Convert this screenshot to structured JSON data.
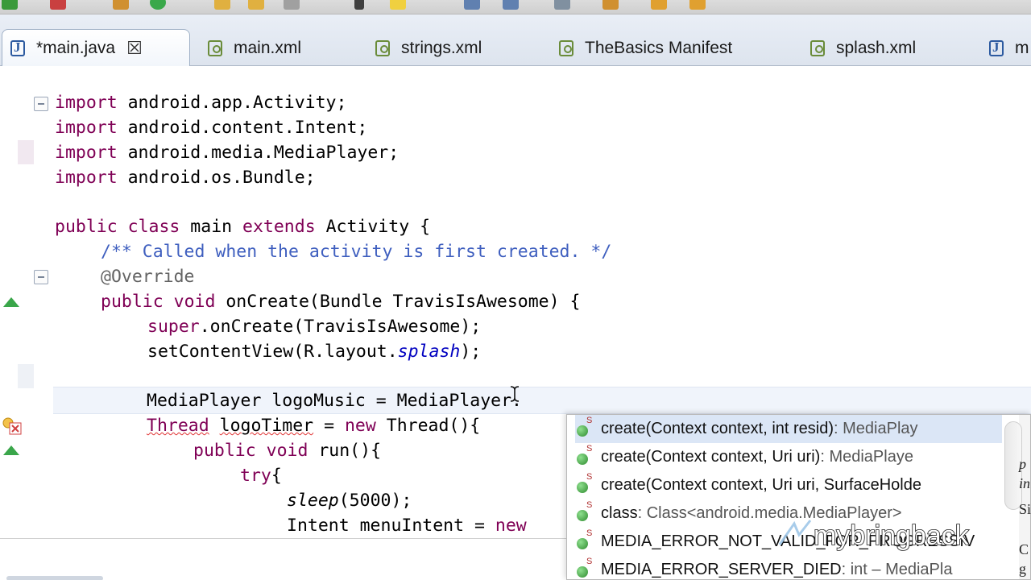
{
  "tabs": [
    {
      "label": "*main.java",
      "icon": "java-file-icon",
      "active": true
    },
    {
      "label": "main.xml",
      "icon": "xml-file-icon"
    },
    {
      "label": "strings.xml",
      "icon": "xml-file-icon"
    },
    {
      "label": "TheBasics Manifest",
      "icon": "xml-file-icon"
    },
    {
      "label": "splash.xml",
      "icon": "xml-file-icon"
    },
    {
      "label": "m",
      "icon": "java-file-icon"
    }
  ],
  "code": {
    "l1_kw": "import",
    "l1": " android.app.Activity;",
    "l2_kw": "import",
    "l2": " android.content.Intent;",
    "l3_kw": "import",
    "l3": " android.media.MediaPlayer;",
    "l4_kw": "import",
    "l4": " android.os.Bundle;",
    "l6_kw1": "public",
    "l6_kw2": "class",
    "l6_a": " main ",
    "l6_kw3": "extends",
    "l6_b": " Activity {",
    "l7": "/** Called when the activity is first created. */",
    "l8": "@Override",
    "l9_kw1": "public",
    "l9_kw2": "void",
    "l9": " onCreate(Bundle TravisIsAwesome) {",
    "l10_kw": "super",
    "l10": ".onCreate(TravisIsAwesome);",
    "l11_a": "setContentView(R.layout.",
    "l11_it": "splash",
    "l11_b": ");",
    "l13": "MediaPlayer logoMusic = MediaPlayer.",
    "l14_err1": "Thread",
    "l14_sp": " ",
    "l14_err2": "logoTimer",
    "l14_a": " = ",
    "l14_kw": "new",
    "l14_b": " Thread(){",
    "l15_kw1": "public",
    "l15_kw2": "void",
    "l15": " run(){",
    "l16_kw": "try",
    "l16": "{",
    "l17_sm": "sleep",
    "l17": "(5000);",
    "l18_a": "Intent menuIntent = ",
    "l18_kw": "new"
  },
  "assist": {
    "proposals": [
      {
        "name": "create(Context context, int resid)",
        "ret": " : MediaPlay"
      },
      {
        "name": "create(Context context, Uri uri)",
        "ret": " : MediaPlaye"
      },
      {
        "name": "create(Context context, Uri uri, SurfaceHolde",
        "ret": ""
      },
      {
        "name": "class",
        "ret": " : Class<android.media.MediaPlayer>"
      },
      {
        "name": "MEDIA_ERROR_NOT_VALID_FOR_PROGRESSIV",
        "ret": ""
      },
      {
        "name": "MEDIA_ERROR_SERVER_DIED",
        "ret": " : int – MediaPla"
      }
    ],
    "side_1": "p",
    "side_2": "in",
    "side_3": "Si",
    "side_4": "C",
    "side_5": "g"
  },
  "watermark": {
    "text": "mybringback",
    "color": "#ffffff"
  },
  "colors": {
    "keyword": "#7f0055",
    "comment": "#3f5fbf",
    "error": "#e03030",
    "tab_active": "#ffffff"
  }
}
